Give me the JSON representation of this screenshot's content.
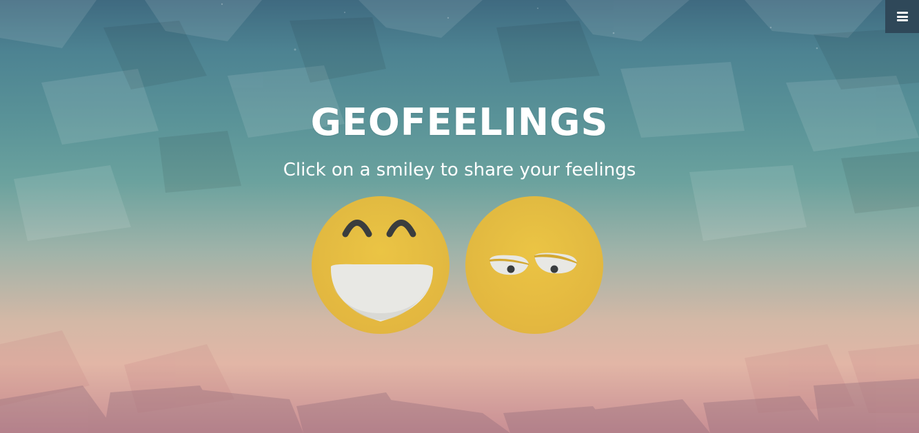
{
  "header": {
    "title": "GEOFEELINGS",
    "subtitle": "Click on a smiley to share your feelings"
  },
  "menu": {
    "icon": "hamburger-menu-icon"
  },
  "smileys": [
    {
      "mood": "happy",
      "icon": "happy-smiley-icon"
    },
    {
      "mood": "sad",
      "icon": "sad-smiley-icon"
    }
  ],
  "colors": {
    "smiley_face": "#e8bc3c",
    "menu_bg": "#2f4859",
    "text": "#ffffff"
  }
}
